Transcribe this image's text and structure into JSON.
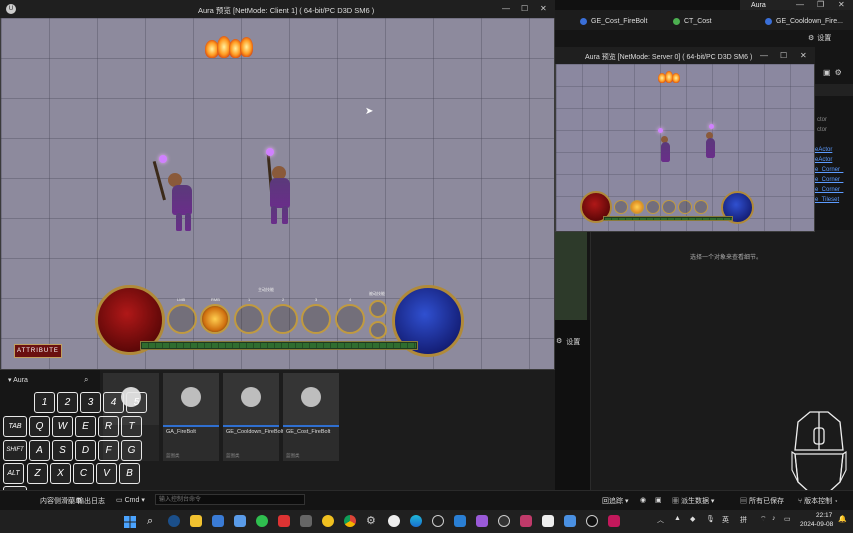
{
  "client_window": {
    "title": "Aura 预览 [NetMode: Client 1]  ( 64-bit/PC D3D SM6 )",
    "controls": [
      "—",
      "☐",
      "✕"
    ]
  },
  "server_window": {
    "title": "Aura 预览 [NetMode: Server 0]  ( 64-bit/PC D3D SM6 )",
    "controls": [
      "—",
      "☐",
      "✕"
    ]
  },
  "editor_tabs": [
    {
      "label": "GE_Cost_FireBolt",
      "color": "#3a6fd8"
    },
    {
      "label": "CT_Cost",
      "color": "#4caf50"
    },
    {
      "label": "GE_Cooldown_Fire...",
      "color": "#3a6fd8"
    }
  ],
  "editor_app_title": "Aura",
  "editor_settings": "设置",
  "outliner": {
    "actor_rows": [
      "ctor",
      "ctor"
    ],
    "links": [
      "eActor",
      "eActor",
      "e_Corner_",
      "e_Corner_",
      "e_Corner_",
      "e_Tileset"
    ]
  },
  "details_hint": "选择一个对象来查看细节。",
  "left_settings": "设置",
  "hud": {
    "attribute_button": "ATTRIBUTE",
    "slot_labels": [
      "LMB",
      "RMB",
      "1",
      "2",
      "3",
      "4"
    ],
    "group_labels": [
      "主动技能",
      "被动技能"
    ]
  },
  "content_browser": {
    "folder": "Aura",
    "assets": [
      {
        "name": "GA_FireBolt",
        "type": "蓝图类"
      },
      {
        "name": "GE_Cooldown_FireBolt",
        "type": "蓝图类"
      },
      {
        "name": "GE_Cost_FireBolt",
        "type": "蓝图类"
      }
    ]
  },
  "keyboard_overlay": {
    "rows": [
      [
        "1",
        "2",
        "3",
        "4",
        "5"
      ],
      [
        "TAB",
        "Q",
        "W",
        "E",
        "R",
        "T"
      ],
      [
        "SHIFT",
        "A",
        "S",
        "D",
        "F",
        "G"
      ],
      [
        "ALT",
        "Z",
        "X",
        "C",
        "V",
        "B"
      ],
      [
        "CTRL"
      ]
    ]
  },
  "status_bar": {
    "content_drawer": "内容侧滑菜单",
    "output_log": "输出日志",
    "cmd": "Cmd",
    "cmd_placeholder": "输入控制台命令",
    "trace": "回追踪",
    "derived_data": "派生数据",
    "all_saved": "所有已保存",
    "source_control": "版本控制"
  },
  "taskbar": {
    "ime_lang": "英",
    "ime_mode": "拼",
    "time": "22:17",
    "date": "2024-09-08"
  }
}
